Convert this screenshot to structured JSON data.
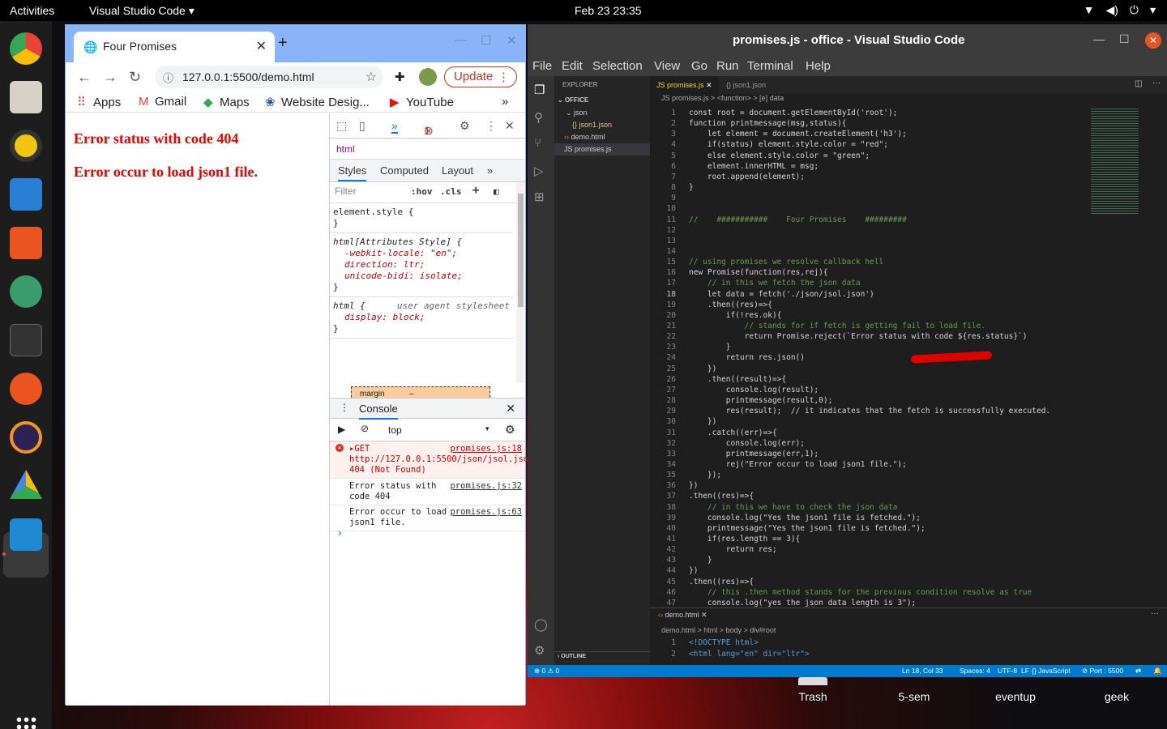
{
  "topbar": {
    "activities": "Activities",
    "app": "Visual Studio Code ▾",
    "clock": "Feb 23  23:35"
  },
  "desktop_icons": [
    "Trash",
    "5-sem",
    "eventup",
    "geek"
  ],
  "chrome": {
    "tab_title": "Four Promises",
    "url": "127.0.0.1:5500/demo.html",
    "update_label": "Update",
    "bookmarks": [
      "Apps",
      "Gmail",
      "Maps",
      "Website Desig...",
      "YouTube"
    ],
    "page_messages": [
      "Error status with code 404",
      "Error occur to load json1 file."
    ]
  },
  "devtools": {
    "error_count": "1",
    "breadcrumb": "html",
    "tabs": [
      "Styles",
      "Computed",
      "Layout"
    ],
    "filter_placeholder": "Filter",
    "hov": ":hov",
    "cls": ".cls",
    "rules": {
      "element_style": "element.style {",
      "attr_style": "html[Attributes Style] {",
      "attr_props": [
        "-webkit-locale: \"en\";",
        "direction: ltr;",
        "unicode-bidi: isolate;"
      ],
      "html_sel": "html {",
      "html_comment": "user agent stylesheet",
      "html_prop": "display: block;"
    },
    "boxmodel_label": "margin",
    "boxmodel_value": "–",
    "console_tab": "Console",
    "context": "top",
    "messages": [
      {
        "text": "▸GET http://127.0.0.1:5500/json/jsol.json 404 (Not Found)",
        "src": "promises.js:18"
      },
      {
        "text": "Error status with code 404",
        "src": "promises.js:32"
      },
      {
        "text": "Error occur to load json1 file.",
        "src": "promises.js:63"
      }
    ]
  },
  "vscode": {
    "title": "promises.js - office - Visual Studio Code",
    "menu": [
      "File",
      "Edit",
      "Selection",
      "View",
      "Go",
      "Run",
      "Terminal",
      "Help"
    ],
    "explorer": "EXPLORER",
    "folder": "OFFICE",
    "tree": [
      "json",
      "{} json1.json",
      "demo.html",
      "JS promises.js"
    ],
    "outline": "OUTLINE",
    "tabs": [
      "JS promises.js",
      "{} json1.json"
    ],
    "breadcrumb": "JS promises.js > <function> > [e] data",
    "code": [
      "const root = document.getElementById('root');",
      "function printmessage(msg,status){",
      "    let element = document.createElement('h3');",
      "    if(status) element.style.color = \"red\";",
      "    else element.style.color = \"green\";",
      "    element.innerHTML = msg;",
      "    root.append(element);",
      "}",
      "",
      "",
      "//    ###########    Four Promises    #########",
      "",
      "",
      "",
      "// using promises we resolve callback hell",
      "new Promise(function(res,rej){",
      "    // in this we fetch the json data",
      "    let data = fetch('./json/jsol.json')",
      "    .then((res)=>{",
      "        if(!res.ok){",
      "            // stands for if fetch is getting fail to load file.",
      "            return Promise.reject(`Error status with code ${res.status}`)",
      "        }",
      "        return res.json()",
      "    })",
      "    .then((result)=>{",
      "        console.log(result);",
      "        printmessage(result,0);",
      "        res(result);  // it indicates that the fetch is successfully executed.",
      "    })",
      "    .catch((err)=>{",
      "        console.log(err);",
      "        printmessage(err,1);",
      "        rej(\"Error occur to load json1 file.\");",
      "    });",
      "})",
      ".then((res)=>{",
      "    // in this we have to check the json data",
      "    console.log(\"Yes the json1 file is fetched.\");",
      "    printmessage(\"Yes the json1 file is fetched.\");",
      "    if(res.length == 3){",
      "        return res;",
      "    }",
      "})",
      ".then((res)=>{",
      "    // this .then method stands for the previous condition resolve as true",
      "    console.log(\"yes the json data length is 3\");"
    ],
    "current_line": 18,
    "panel_tab": "demo.html",
    "panel_breadcrumb": "demo.html > html > body > div#root",
    "panel_code": [
      "<!DOCTYPE html>",
      "<html lang=\"en\" dir=\"ltr\">"
    ],
    "status_left": "⊗ 0 ⚠ 0",
    "status_right": [
      "Ln 18, Col 33",
      "Spaces: 4",
      "UTF-8",
      "LF",
      "{} JavaScript",
      "⊘ Port : 5500"
    ]
  }
}
